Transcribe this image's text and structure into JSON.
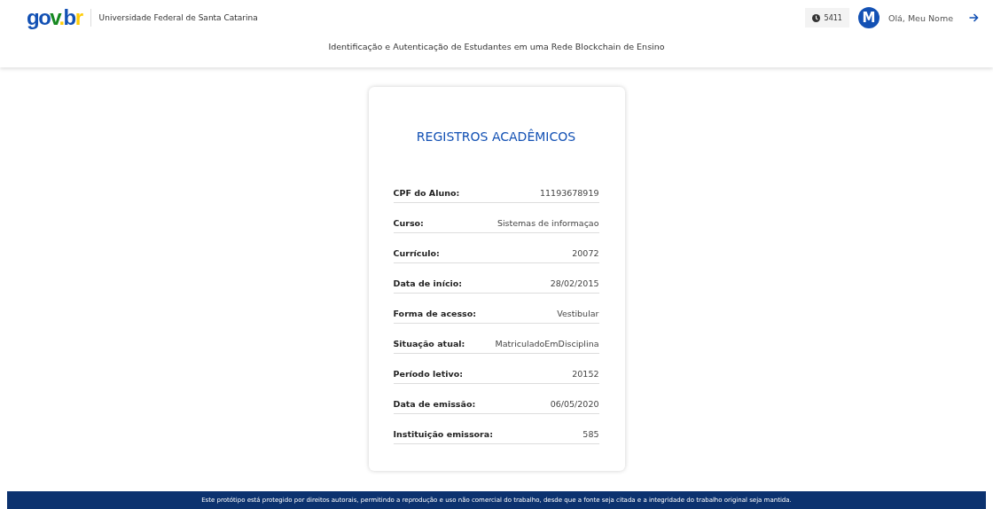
{
  "header": {
    "logo": {
      "parts": [
        {
          "text": "g",
          "color": "#1351b4"
        },
        {
          "text": "o",
          "color": "#1351b4"
        },
        {
          "text": "v",
          "color": "#168821"
        },
        {
          "text": ".",
          "color": "#ffcd07"
        },
        {
          "text": "b",
          "color": "#1351b4"
        },
        {
          "text": "r",
          "color": "#ffcd07"
        }
      ]
    },
    "institution": "Universidade Federal de Santa Catarina",
    "timer": "5411",
    "avatar": "M",
    "greeting": "Olá, Meu Nome",
    "subtitle": "Identificação e Autenticação de Estudantes em uma Rede Blockchain de Ensino"
  },
  "card": {
    "title": "REGISTROS ACADÊMICOS",
    "fields": [
      {
        "label": "CPF do Aluno:",
        "value": "11193678919"
      },
      {
        "label": "Curso:",
        "value": "Sistemas de informaçao"
      },
      {
        "label": "Currículo:",
        "value": "20072"
      },
      {
        "label": "Data de início:",
        "value": "28/02/2015"
      },
      {
        "label": "Forma de acesso:",
        "value": "Vestibular"
      },
      {
        "label": "Situação atual:",
        "value": "MatriculadoEmDisciplina"
      },
      {
        "label": "Período letivo:",
        "value": "20152"
      },
      {
        "label": "Data de emissão:",
        "value": "06/05/2020"
      },
      {
        "label": "Instituição emissora:",
        "value": "585"
      }
    ]
  },
  "footer": "Este protótipo está protegido por direitos autorais, permitindo a reprodução e uso não comercial do trabalho, desde que a fonte seja citada e a integridade do trabalho original seja mantida."
}
